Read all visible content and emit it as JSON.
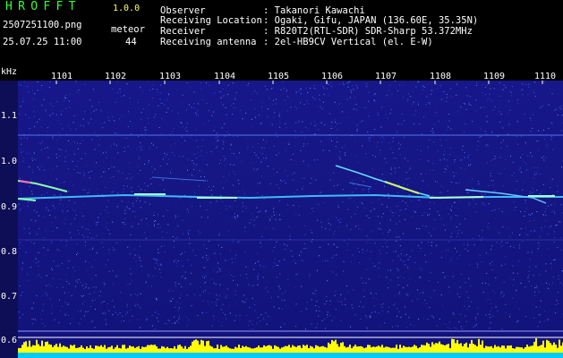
{
  "app": {
    "title": "HROFFT",
    "version": "1.0.0",
    "filename": "2507251100.png",
    "datetime": "25.07.25 11:00",
    "meteor_label": "meteor",
    "meteor_count": "44"
  },
  "info": {
    "observer_label": "Observer",
    "observer_value": ": Takanori Kawachi",
    "location_label": "Receiving Location",
    "location_value": ": Ogaki, Gifu, JAPAN (136.60E, 35.35N)",
    "receiver_label": "Receiver",
    "receiver_value": ": R820T2(RTL-SDR) SDR-Sharp 53.372MHz",
    "antenna_label": "Receiving antenna",
    "antenna_value": ": 2el-HB9CV Vertical (el. E-W)"
  },
  "axis": {
    "y_unit": "kHz",
    "minutes": [
      "1101",
      "1102",
      "1103",
      "1104",
      "1105",
      "1106",
      "1107",
      "1108",
      "1109",
      "1110"
    ],
    "freq_ticks": [
      "1.1",
      "1.0",
      "0.9",
      "0.8",
      "0.7",
      "0.6"
    ]
  },
  "colors": {
    "background": "#000000",
    "panel": "#16168a",
    "title": "#33ff33",
    "version": "#ffff66",
    "signal": "#44ddff",
    "echo": "#66ff88",
    "strong": "#ff66aa",
    "activity": "#ffff00",
    "activity_base": "#00ccff"
  }
}
